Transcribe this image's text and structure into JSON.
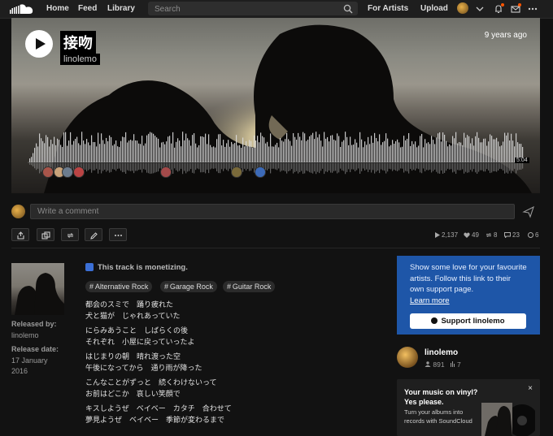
{
  "nav": {
    "links": [
      "Home",
      "Feed",
      "Library"
    ],
    "search_placeholder": "Search",
    "for_artists": "For Artists",
    "upload": "Upload"
  },
  "track": {
    "title": "接吻",
    "artist": "linolemo",
    "age": "9 years ago",
    "duration": "5:04"
  },
  "comment": {
    "placeholder": "Write a comment"
  },
  "stats": {
    "plays": "2,137",
    "likes": "49",
    "reposts": "8",
    "comments": "23",
    "monetization": "6"
  },
  "meta": {
    "released_by_label": "Released by:",
    "released_by": "linolemo",
    "release_date_label": "Release date:",
    "release_date_line1": "17 January",
    "release_date_line2": "2016"
  },
  "monetizing_text": "This track is monetizing.",
  "tags": [
    "Alternative Rock",
    "Garage Rock",
    "Guitar Rock"
  ],
  "lyrics": [
    [
      "都会のスミで　踊り疲れた",
      "犬と猫が　じゃれあっていた"
    ],
    [
      "にらみあうこと　しばらくの後",
      "それぞれ　小屋に戻っていったよ"
    ],
    [
      "はじまりの朝　晴れ渡った空",
      "午後になってから　通り雨が降った"
    ],
    [
      "こんなことがずっと　続くわけないって",
      "お前はどこか　哀しい笑顔で"
    ],
    [
      "キスしようぜ　ベイベー　カタチ　合わせて",
      "夢見ようぜ　ベイベー　季節が変わるまで"
    ]
  ],
  "support": {
    "text": "Show some love for your favourite artists. Follow this link to their own support page.",
    "learn_more": "Learn more",
    "button": "Support linolemo"
  },
  "artist_card": {
    "name": "linolemo",
    "followers": "891",
    "tracks": "7"
  },
  "vinyl": {
    "title_line1": "Your music on vinyl?",
    "title_line2": "Yes please.",
    "text": "Turn your albums into records with SoundCloud",
    "close": "×"
  },
  "colors": {
    "accent": "#ff5500",
    "support_bg": "#1e56a8",
    "background": "#121212"
  }
}
